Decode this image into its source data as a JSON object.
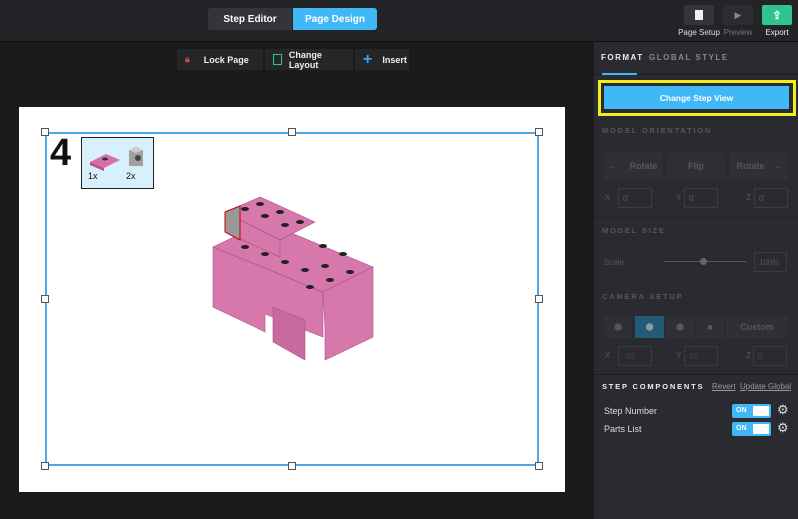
{
  "header": {
    "tabs": [
      {
        "label": "Step Editor",
        "active": false
      },
      {
        "label": "Page Design",
        "active": true
      }
    ],
    "actions": [
      {
        "label": "Page Setup",
        "icon": "page-icon"
      },
      {
        "label": "Preview",
        "icon": "play-icon"
      },
      {
        "label": "Export",
        "icon": "export-icon"
      }
    ]
  },
  "toolbar": {
    "lock": "Lock Page",
    "layout": "Change Layout",
    "insert": "Insert"
  },
  "canvas": {
    "step_number": "4",
    "parts": [
      {
        "qty": "1x",
        "color": "#d670aa"
      },
      {
        "qty": "2x",
        "color": "#a0a0a0"
      }
    ]
  },
  "panel": {
    "tabs": [
      "FORMAT",
      "GLOBAL STYLE"
    ],
    "change_step_view": "Change Step View",
    "model_orientation": {
      "title": "MODEL ORIENTATION",
      "rotate_left": "Rotate",
      "flip": "Flip",
      "rotate_right": "Rotate",
      "x": "0'",
      "y": "0'",
      "z": "0'"
    },
    "model_size": {
      "title": "MODEL SIZE",
      "scale_label": "Scale",
      "scale_value": "100%",
      "scale_fraction": 0.5
    },
    "camera": {
      "title": "CAMERA SETUP",
      "custom": "Custom",
      "x": "-30",
      "y": "45",
      "z": "0'"
    },
    "components": {
      "title": "STEP COMPONENTS",
      "revert": "Revert",
      "update_global": "Update Global",
      "items": [
        {
          "label": "Step Number",
          "state": "ON"
        },
        {
          "label": "Parts List",
          "state": "ON"
        }
      ]
    },
    "axes": [
      "X",
      "Y",
      "Z"
    ]
  }
}
